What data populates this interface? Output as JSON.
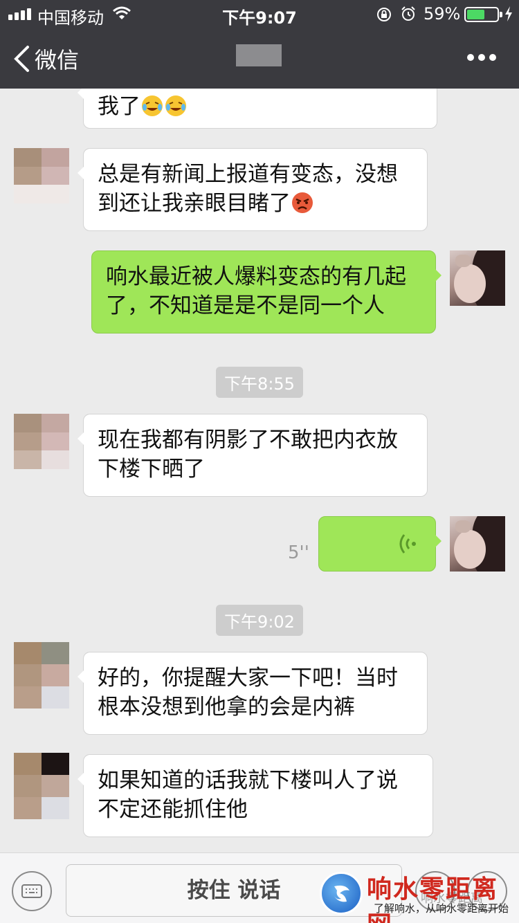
{
  "status_bar": {
    "carrier": "中国移动",
    "time": "下午9:07",
    "battery_percent": "59%",
    "battery_level": 0.59
  },
  "nav": {
    "back_label": "微信"
  },
  "messages": [
    {
      "side": "left",
      "text": "我了"
    },
    {
      "side": "left",
      "text": "总是有新闻上报道有变态，没想到还让我亲眼目睹了"
    },
    {
      "side": "right",
      "text": "响水最近被人爆料变态的有几起了，不知道是是不是同一个人"
    },
    {
      "type": "time",
      "text": "下午8:55"
    },
    {
      "side": "left",
      "text": "现在我都有阴影了不敢把内衣放下楼下晒了"
    },
    {
      "side": "right",
      "type": "voice",
      "duration": "5''"
    },
    {
      "type": "time",
      "text": "下午9:02"
    },
    {
      "side": "left",
      "text": "好的，你提醒大家一下吧！当时根本没想到他拿的会是内裤"
    },
    {
      "side": "left",
      "text": "如果知道的话我就下楼叫人了说不定还能抓住他"
    }
  ],
  "input_bar": {
    "hold_to_talk": "按住 说话"
  },
  "watermark": {
    "title": "响水零距离网",
    "subtitle": "了解响水，从响水零距离开始",
    "overlay": "响水零距离"
  },
  "colors": {
    "nav_bg": "#3a3a3f",
    "chat_bg": "#ebebeb",
    "sent_bubble": "#9fe658",
    "received_bubble": "#ffffff",
    "watermark_red": "#d0281e"
  }
}
